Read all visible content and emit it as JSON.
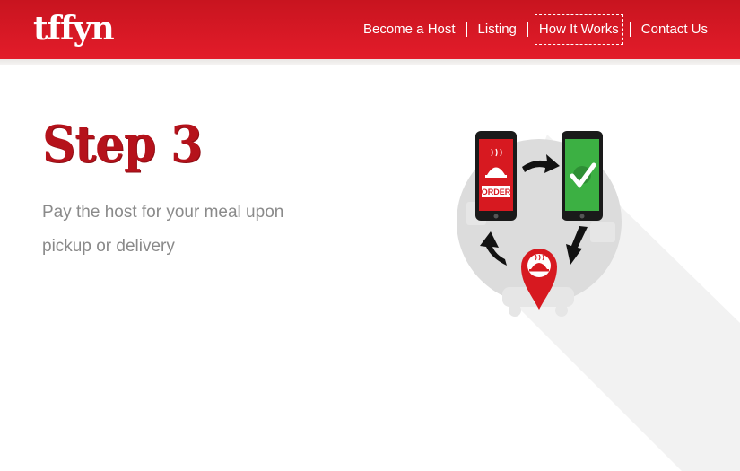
{
  "header": {
    "logo": "tffyn",
    "nav": [
      {
        "label": "Become a Host"
      },
      {
        "label": "Listing"
      },
      {
        "label": "How It Works",
        "active": true
      },
      {
        "label": "Contact Us"
      }
    ]
  },
  "content": {
    "title": "Step 3",
    "description": "Pay the host for your meal upon pickup or delivery"
  },
  "illustration": {
    "order_label": "ORDER",
    "icons": [
      "phone-order-icon",
      "phone-check-icon",
      "location-pin-icon",
      "cycle-arrows-icon"
    ]
  },
  "colors": {
    "brand_red": "#e31c2a",
    "title_red": "#b5121b",
    "confirm_green": "#3cb043",
    "desc_gray": "#8a8a8a"
  }
}
